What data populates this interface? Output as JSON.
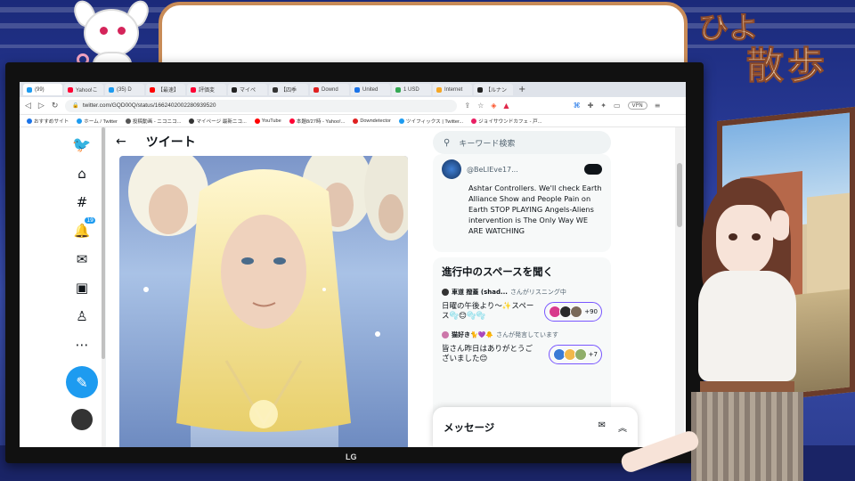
{
  "overlay": {
    "title_line1": "ひよ",
    "title_line2": "散歩",
    "monitor_brand": "LG"
  },
  "browser": {
    "tabs": [
      {
        "label": "(99)",
        "color": "#1d9bf0",
        "active": true
      },
      {
        "label": "Yahoo!こ",
        "color": "#ff0033"
      },
      {
        "label": "(35) D",
        "color": "#1d9bf0"
      },
      {
        "label": "【最速】",
        "color": "#ff0000"
      },
      {
        "label": "評価変",
        "color": "#ff0033"
      },
      {
        "label": "マイペ",
        "color": "#222222"
      },
      {
        "label": "【四季",
        "color": "#333333"
      },
      {
        "label": "Downd",
        "color": "#e02020"
      },
      {
        "label": "United",
        "color": "#1a73e8"
      },
      {
        "label": "1 USD",
        "color": "#34a853"
      },
      {
        "label": "Internet",
        "color": "#f5a623"
      },
      {
        "label": "【ルナン",
        "color": "#222222"
      }
    ],
    "new_tab": "+",
    "url": "twitter.com/GQD00Q/status/1662402002280939520",
    "vpn": "VPN",
    "bookmarks": [
      {
        "label": "おすすめサイト",
        "color": "#1a73e8"
      },
      {
        "label": "ホーム / Twitter",
        "color": "#1d9bf0"
      },
      {
        "label": "投稿動画 - ニコニコ...",
        "color": "#555555"
      },
      {
        "label": "マイページ 最新ニコ...",
        "color": "#333333"
      },
      {
        "label": "YouTube",
        "color": "#ff0000"
      },
      {
        "label": "本題8/27時 - Yahoo!...",
        "color": "#ff0033"
      },
      {
        "label": "Downdetector",
        "color": "#e02020"
      },
      {
        "label": "ツイフィックス | Twitter...",
        "color": "#1d9bf0"
      },
      {
        "label": "ジョイサウンドカフェ - 戸...",
        "color": "#e91e63"
      }
    ]
  },
  "twitter": {
    "nav": {
      "notifications_badge": "19"
    },
    "header": {
      "back": "←",
      "title": "ツイート"
    },
    "search_placeholder": "キーワード検索",
    "card": {
      "handle": "@BeLIEve17...",
      "text": "Ashtar Controllers. We'll check Earth Alliance Show and People Pain on Earth STOP PLAYING Angels-Aliens intervention is The Only Way WE ARE WATCHING"
    },
    "spaces": {
      "heading": "進行中のスペースを聞く",
      "items": [
        {
          "host_name": "車道 撥蓋 (shad...",
          "host_status": "さんがリスニング中",
          "title": "日曜の午後より〜✨スペース🫧😊🫧🫧",
          "count": "+90"
        },
        {
          "host_name": "猫好き🐈💜🐥",
          "host_status": "さんが発言しています",
          "title": "皆さん昨日はありがとうございました😊",
          "count": "+7"
        }
      ]
    },
    "messages_label": "メッセージ"
  }
}
